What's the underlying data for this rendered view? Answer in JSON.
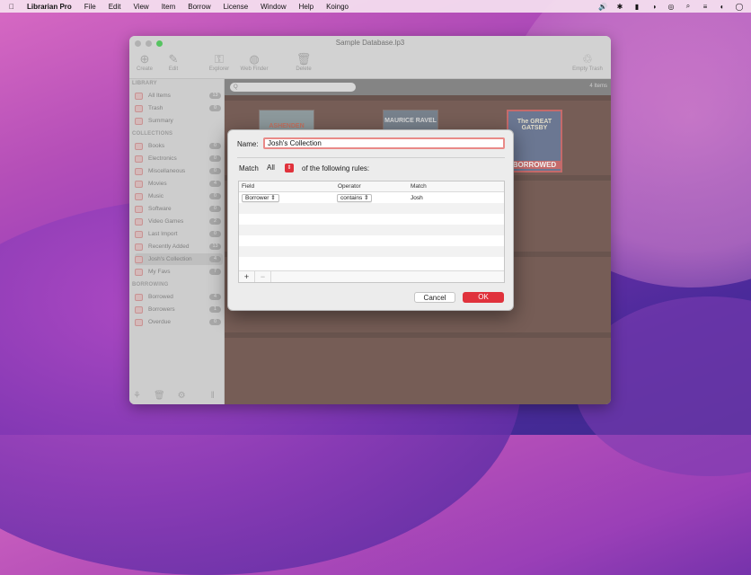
{
  "menubar": {
    "apple": "",
    "items": [
      "Librarian Pro",
      "File",
      "Edit",
      "View",
      "Item",
      "Borrow",
      "License",
      "Window",
      "Help",
      "Koingo"
    ],
    "status_icons": [
      "🔊",
      "✱",
      "▮",
      "◑",
      "◎",
      "⌕",
      "≡",
      "◐",
      "◯"
    ]
  },
  "window": {
    "title": "Sample Database.lp3",
    "toolbar": [
      "Create",
      "Edit",
      "Explorer",
      "Web Finder",
      "Delete",
      "Empty Trash"
    ]
  },
  "sidebar": {
    "sections": [
      {
        "header": "LIBRARY",
        "items": [
          {
            "label": "All Items",
            "count": "13"
          },
          {
            "label": "Trash",
            "count": "0"
          },
          {
            "label": "Summary",
            "count": ""
          }
        ]
      },
      {
        "header": "COLLECTIONS",
        "items": [
          {
            "label": "Books",
            "count": "0"
          },
          {
            "label": "Electronics",
            "count": "0"
          },
          {
            "label": "Miscellaneous",
            "count": "0"
          },
          {
            "label": "Movies",
            "count": "4"
          },
          {
            "label": "Music",
            "count": "0"
          },
          {
            "label": "Software",
            "count": "0"
          },
          {
            "label": "Video Games",
            "count": "2"
          },
          {
            "label": "Last Import",
            "count": "0"
          },
          {
            "label": "Recently Added",
            "count": "13"
          },
          {
            "label": "Josh's Collection",
            "count": "4"
          },
          {
            "label": "My Favs",
            "count": "7"
          }
        ]
      },
      {
        "header": "BORROWING",
        "items": [
          {
            "label": "Borrowed",
            "count": "4"
          },
          {
            "label": "Borrowers",
            "count": "1"
          },
          {
            "label": "Overdue",
            "count": "0"
          }
        ]
      }
    ]
  },
  "content": {
    "search_placeholder": "Q",
    "items_count": "4 Items",
    "books": [
      {
        "title": "ASHENDEN",
        "badge": ""
      },
      {
        "title": "MAURICE RAVEL",
        "badge": ""
      },
      {
        "title": "The GREAT GATSBY",
        "badge": "BORROWED"
      }
    ]
  },
  "dialog": {
    "name_label": "Name:",
    "name_value": "Josh's Collection",
    "match_label": "Match",
    "match_value": "All",
    "match_suffix": "of the following rules:",
    "columns": [
      "Field",
      "Operator",
      "Match"
    ],
    "rows": [
      {
        "field": "Borrower",
        "operator": "contains",
        "match": "Josh"
      }
    ],
    "add_label": "+",
    "remove_label": "−",
    "cancel": "Cancel",
    "ok": "OK"
  },
  "colors": {
    "accent": "#e0323c",
    "shelf": "#5b3a31"
  }
}
